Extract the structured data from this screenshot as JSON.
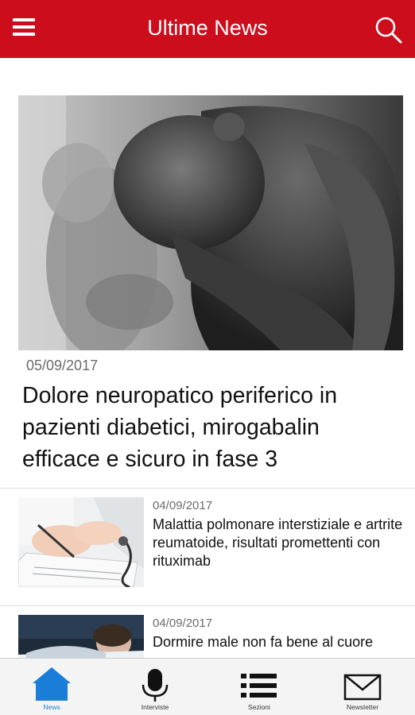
{
  "header": {
    "title": "Ultime News"
  },
  "hero": {
    "date": "05/09/2017",
    "title": "Dolore neuropatico periferico in pazienti diabetici, mirogabalin efficace e sicuro in fase 3"
  },
  "articles": [
    {
      "date": "04/09/2017",
      "title": "Malattia polmonare interstiziale e artrite reumatoide, risultati promettenti con rituximab"
    },
    {
      "date": "04/09/2017",
      "title": "Dormire male non fa bene al cuore"
    }
  ],
  "tabs": [
    {
      "label": "News",
      "icon": "home-icon",
      "active": true
    },
    {
      "label": "Interviste",
      "icon": "microphone-icon",
      "active": false
    },
    {
      "label": "Sezioni",
      "icon": "list-icon",
      "active": false
    },
    {
      "label": "Newsletter",
      "icon": "envelope-icon",
      "active": false
    }
  ],
  "colors": {
    "brand": "#cc0d1c",
    "active_tab": "#1a7ed8"
  }
}
